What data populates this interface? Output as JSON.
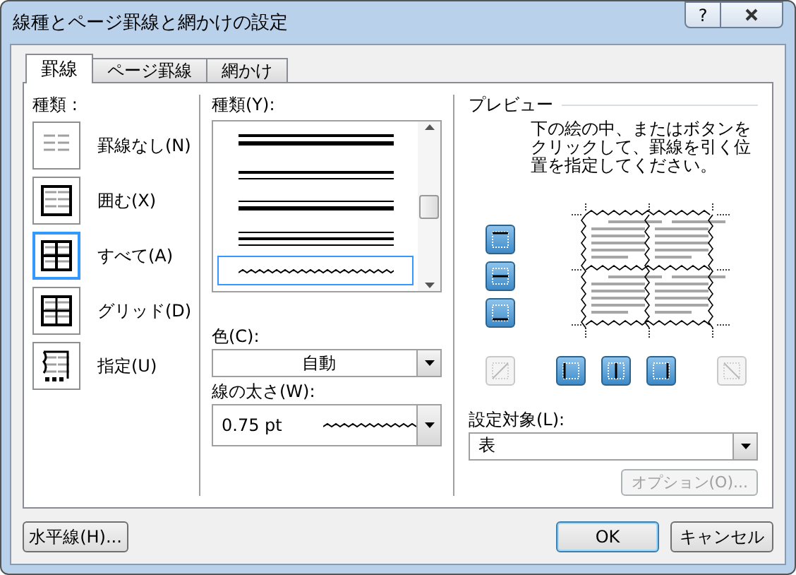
{
  "window": {
    "title": "線種とページ罫線と網かけの設定",
    "help": "?"
  },
  "tabs": [
    {
      "label": "罫線",
      "selected": true
    },
    {
      "label": "ページ罫線",
      "selected": false
    },
    {
      "label": "網かけ",
      "selected": false
    }
  ],
  "setting": {
    "label": "種類 :",
    "items": [
      {
        "kind": "none",
        "label": "罫線なし(N)",
        "selected": false
      },
      {
        "kind": "box",
        "label": "囲む(X)",
        "selected": false
      },
      {
        "kind": "all",
        "label": "すべて(A)",
        "selected": true
      },
      {
        "kind": "grid",
        "label": "グリッド(D)",
        "selected": false
      },
      {
        "kind": "custom",
        "label": "指定(U)",
        "selected": false
      }
    ]
  },
  "style": {
    "label": "種類(Y):",
    "lines": [
      {
        "kind": "thick-thick",
        "selected": false
      },
      {
        "kind": "thin-thin",
        "selected": false
      },
      {
        "kind": "thin-thick",
        "selected": false
      },
      {
        "kind": "thin-thick-thin",
        "selected": false
      },
      {
        "kind": "wavy",
        "selected": true
      }
    ]
  },
  "color": {
    "label": "色(C):",
    "value": "自動"
  },
  "width": {
    "label": "線の太さ(W):",
    "value": "0.75 pt"
  },
  "preview": {
    "label": "プレビュー",
    "instructions": "下の絵の中、またはボタンをクリックして、罫線を引く位置を指定してください。",
    "side_buttons": [
      {
        "kind": "top",
        "disabled": false
      },
      {
        "kind": "middle",
        "disabled": false
      },
      {
        "kind": "bottom",
        "disabled": false
      }
    ],
    "bottom_buttons": [
      {
        "kind": "diag-up",
        "disabled": true
      },
      {
        "kind": "left",
        "disabled": false
      },
      {
        "kind": "center",
        "disabled": false
      },
      {
        "kind": "right",
        "disabled": false
      },
      {
        "kind": "diag-down",
        "disabled": true
      }
    ]
  },
  "apply_to": {
    "label": "設定対象(L):",
    "value": "表"
  },
  "options_button": {
    "label": "オプション(O)...",
    "disabled": true
  },
  "footer": {
    "horizontal_line": "水平線(H)...",
    "ok": "OK",
    "cancel": "キャンセル"
  }
}
